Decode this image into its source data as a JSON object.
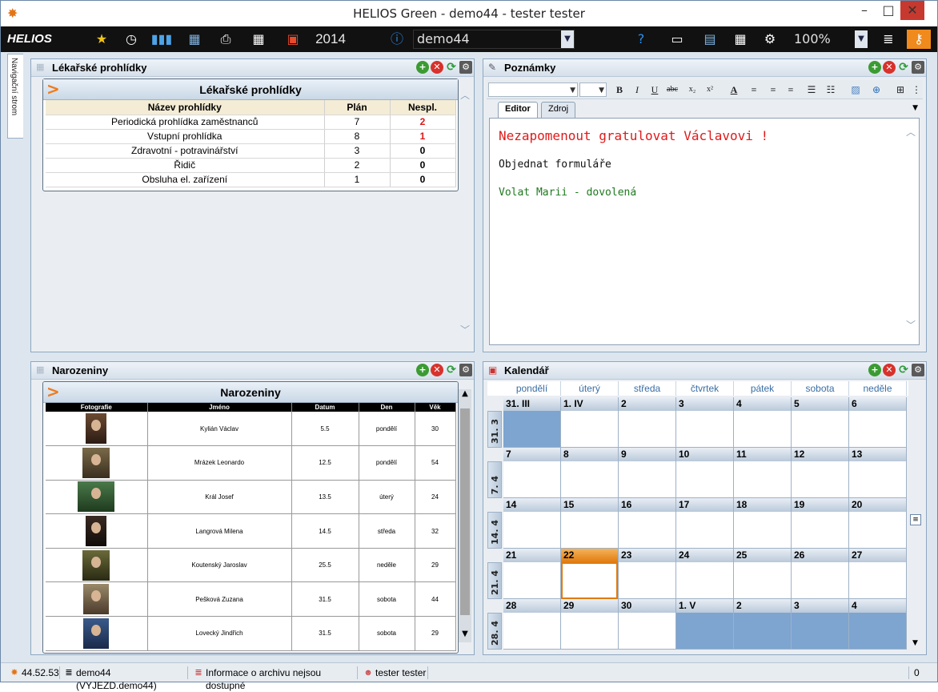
{
  "window": {
    "title": "HELIOS Green - demo44 - tester tester",
    "minimize": "–",
    "maximize": "□",
    "close": "✕"
  },
  "toolbar": {
    "logo": "HELIOS",
    "year": "2014",
    "db_combo": "demo44",
    "zoom_combo": "100%"
  },
  "nav_tab": "Navigační strom",
  "panels": {
    "exams": {
      "title": "Lékařské prohlídky",
      "grid_title": "Lékařské prohlídky",
      "columns": [
        "Název prohlídky",
        "Plán",
        "Nespl."
      ],
      "rows": [
        [
          "Periodická prohlídka zaměstnanců",
          "7",
          "2"
        ],
        [
          "Vstupní prohlídka",
          "8",
          "1"
        ],
        [
          "Zdravotní - potravinářství",
          "3",
          "0"
        ],
        [
          "Řidič",
          "2",
          "0"
        ],
        [
          "Obsluha el. zařízení",
          "1",
          "0"
        ]
      ]
    },
    "notes": {
      "title": "Poznámky",
      "tab_editor": "Editor",
      "tab_source": "Zdroj",
      "line1": "Nezapomenout gratulovat Václavovi !",
      "line2": "Objednat formuláře",
      "line3": "Volat Marii - dovolená",
      "colors": {
        "line1": "#e01a1a",
        "line2": "#111111",
        "line3": "#1f7a1f"
      }
    },
    "birthdays": {
      "title": "Narozeniny",
      "grid_title": "Narozeniny",
      "columns": [
        "Fotografie",
        "Jméno",
        "Datum",
        "Den",
        "Věk"
      ],
      "rows": [
        [
          "Kylián Václav",
          "5.5",
          "pondělí",
          "30"
        ],
        [
          "Mrázek Leonardo",
          "12.5",
          "pondělí",
          "54"
        ],
        [
          "Král Josef",
          "13.5",
          "úterý",
          "24"
        ],
        [
          "Langrová Milena",
          "14.5",
          "středa",
          "32"
        ],
        [
          "Koutenský Jaroslav",
          "25.5",
          "neděle",
          "29"
        ],
        [
          "Pešková Zuzana",
          "31.5",
          "sobota",
          "44"
        ],
        [
          "Lovecký Jindřich",
          "31.5",
          "sobota",
          "29"
        ]
      ]
    },
    "calendar": {
      "title": "Kalendář",
      "days": [
        "pondělí",
        "úterý",
        "středa",
        "čtvrtek",
        "pátek",
        "sobota",
        "neděle"
      ],
      "weeks": [
        {
          "label": "31. 3",
          "dates": [
            "31. III",
            "1. IV",
            "2",
            "3",
            "4",
            "5",
            "6"
          ],
          "other": [
            0
          ]
        },
        {
          "label": "7. 4",
          "dates": [
            "7",
            "8",
            "9",
            "10",
            "11",
            "12",
            "13"
          ],
          "other": []
        },
        {
          "label": "14. 4",
          "dates": [
            "14",
            "15",
            "16",
            "17",
            "18",
            "19",
            "20"
          ],
          "other": []
        },
        {
          "label": "21. 4",
          "dates": [
            "21",
            "22",
            "23",
            "24",
            "25",
            "26",
            "27"
          ],
          "other": [],
          "today": 1
        },
        {
          "label": "28. 4",
          "dates": [
            "28",
            "29",
            "30",
            "1. V",
            "2",
            "3",
            "4"
          ],
          "other": [
            3,
            4,
            5,
            6
          ]
        }
      ]
    }
  },
  "status": {
    "version": "44.52.53",
    "db": "demo44 (VYJEZD.demo44)",
    "archive": "Informace o archivu nejsou dostupné",
    "user": "tester tester",
    "count": "0"
  }
}
